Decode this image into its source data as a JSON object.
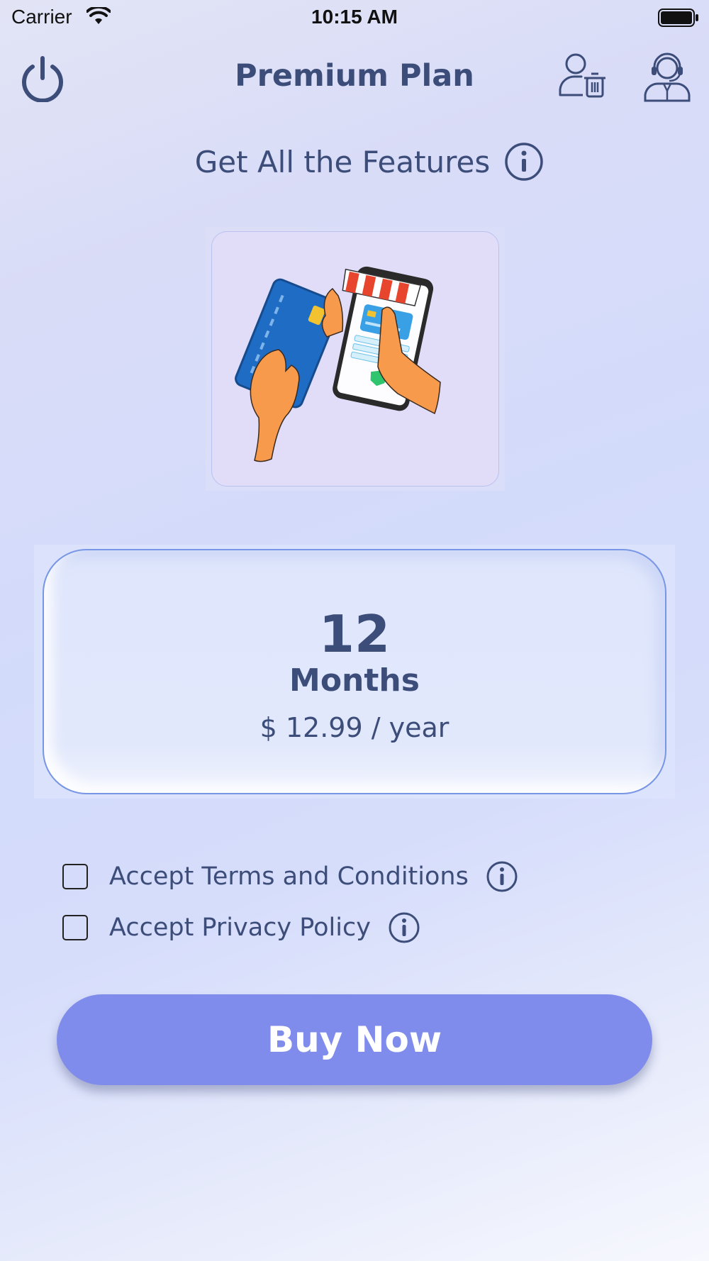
{
  "status_bar": {
    "carrier": "Carrier",
    "time": "10:15 AM"
  },
  "header": {
    "title": "Premium Plan"
  },
  "subtitle": "Get All the Features",
  "plan": {
    "duration": "12",
    "unit": "Months",
    "price": "$ 12.99 / year"
  },
  "checkboxes": [
    {
      "label": "Accept Terms and Conditions",
      "checked": false
    },
    {
      "label": "Accept Privacy Policy",
      "checked": false
    }
  ],
  "buy_button": {
    "label": "Buy Now"
  },
  "colors": {
    "primary_text": "#3d4d7a",
    "button": "#808ceb",
    "card_border": "#7896e6"
  }
}
